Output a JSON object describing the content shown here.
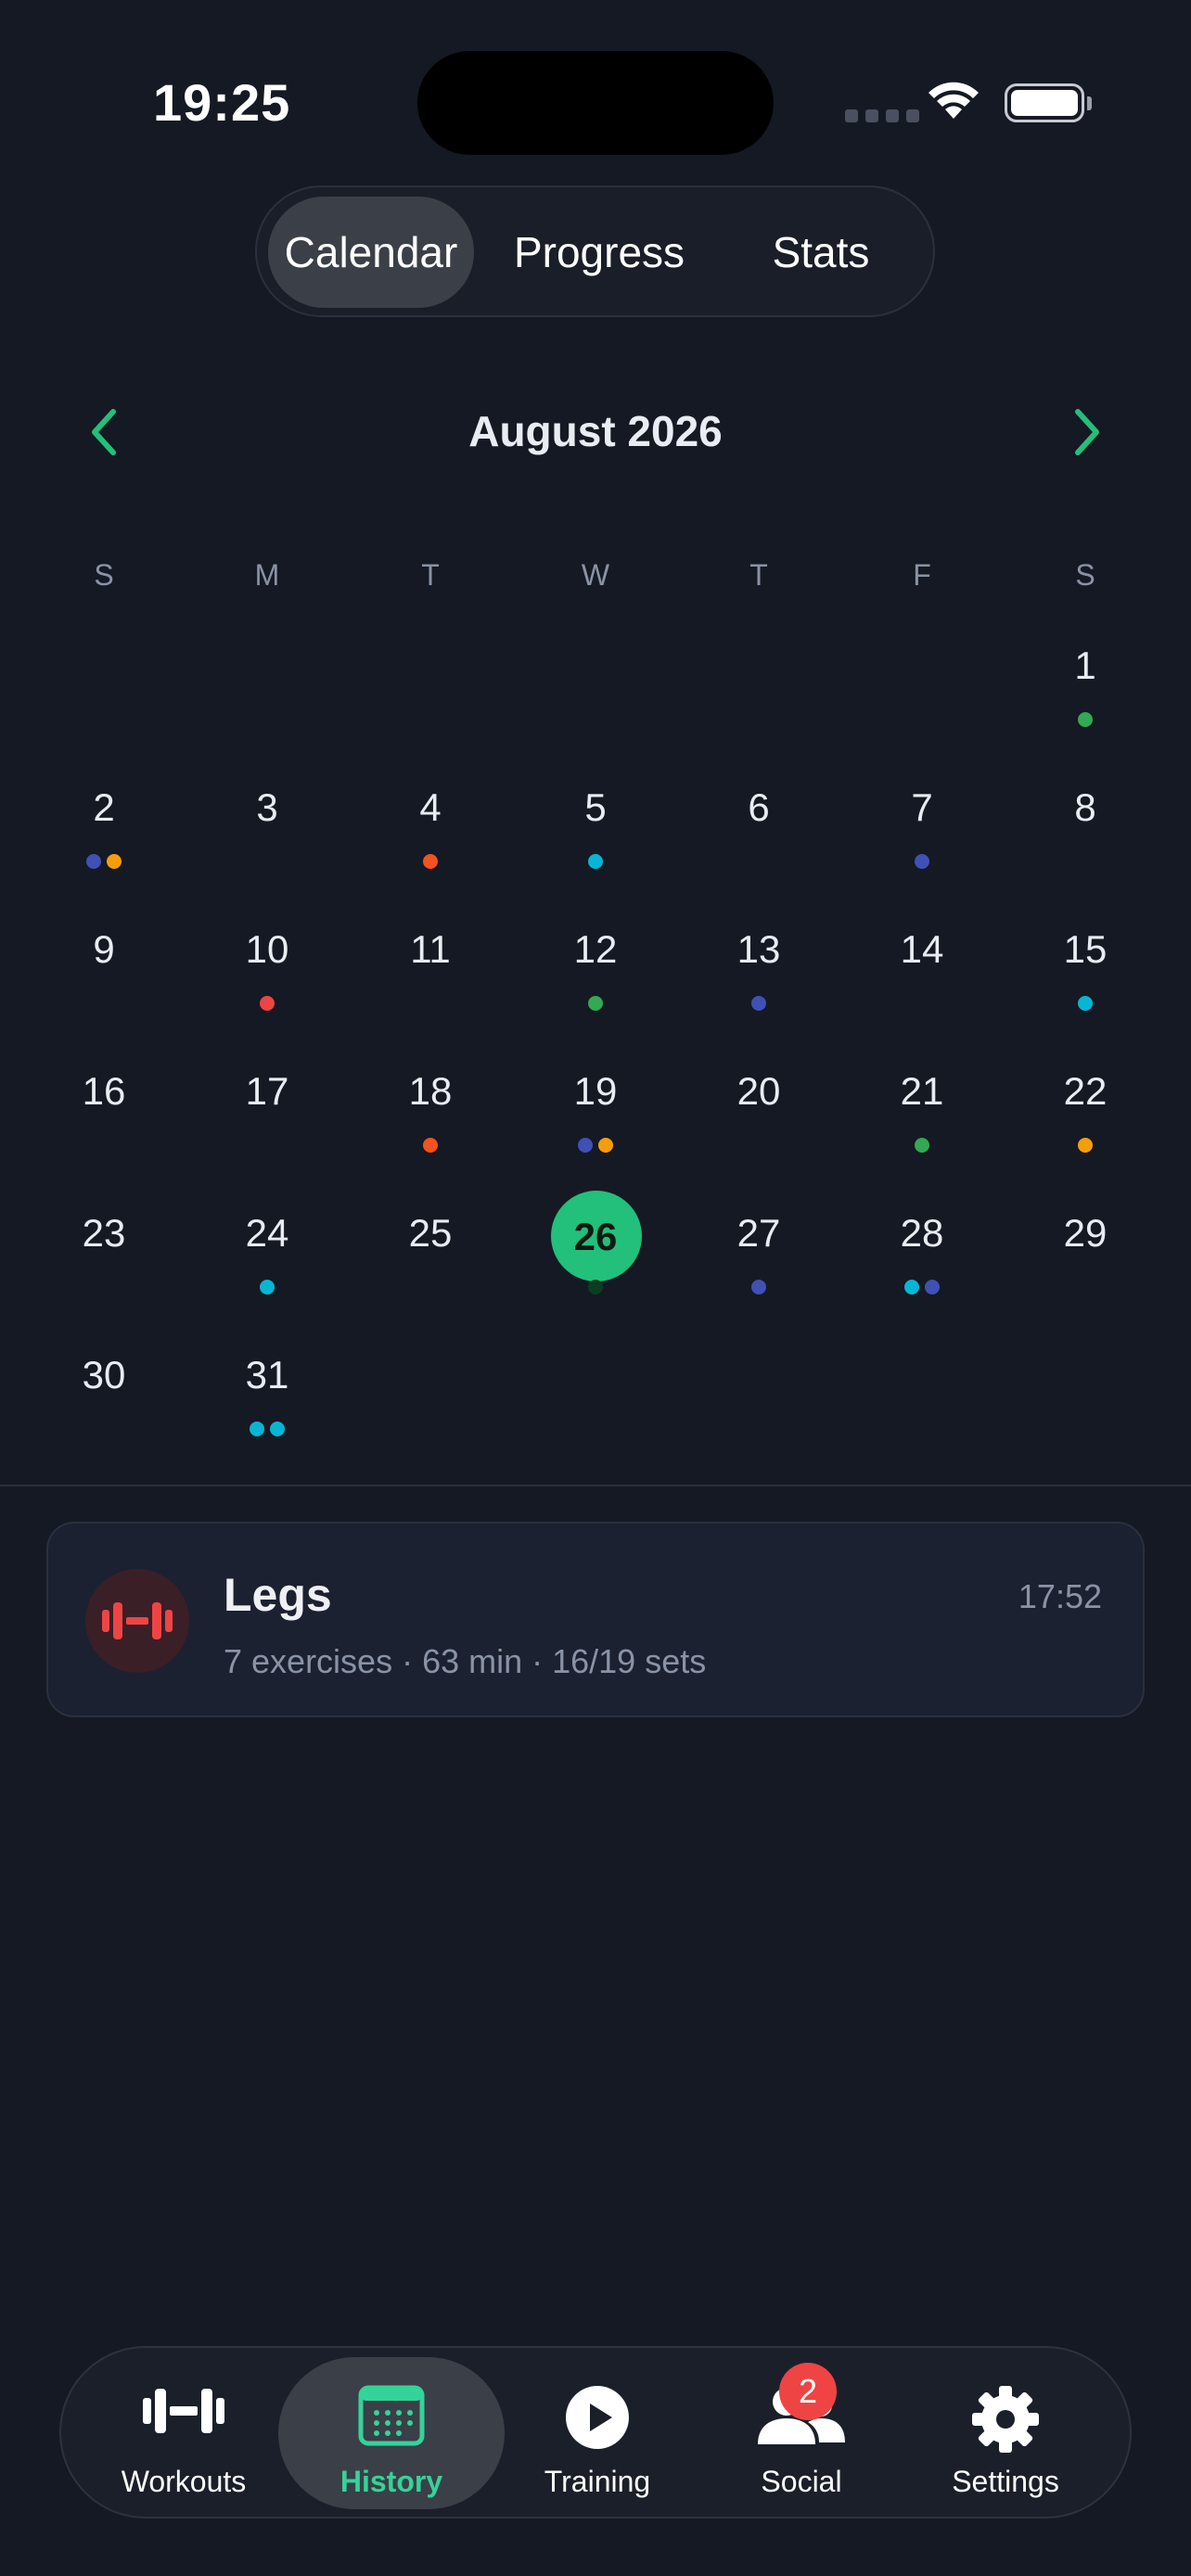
{
  "status_bar": {
    "time": "19:25"
  },
  "segmented": {
    "calendar": "Calendar",
    "progress": "Progress",
    "stats": "Stats",
    "selected": "Calendar"
  },
  "calendar": {
    "month_title": "August 2026",
    "weekdays": [
      "S",
      "M",
      "T",
      "W",
      "T",
      "F",
      "S"
    ],
    "today": 26,
    "days": [
      {
        "n": "1",
        "col": 6,
        "row": 0,
        "dots": [
          "green"
        ]
      },
      {
        "n": "2",
        "col": 0,
        "row": 1,
        "dots": [
          "indigo",
          "orange"
        ]
      },
      {
        "n": "3",
        "col": 1,
        "row": 1,
        "dots": []
      },
      {
        "n": "4",
        "col": 2,
        "row": 1,
        "dots": [
          "red-orange"
        ]
      },
      {
        "n": "5",
        "col": 3,
        "row": 1,
        "dots": [
          "cyan"
        ]
      },
      {
        "n": "6",
        "col": 4,
        "row": 1,
        "dots": []
      },
      {
        "n": "7",
        "col": 5,
        "row": 1,
        "dots": [
          "indigo"
        ]
      },
      {
        "n": "8",
        "col": 6,
        "row": 1,
        "dots": []
      },
      {
        "n": "9",
        "col": 0,
        "row": 2,
        "dots": []
      },
      {
        "n": "10",
        "col": 1,
        "row": 2,
        "dots": [
          "red"
        ]
      },
      {
        "n": "11",
        "col": 2,
        "row": 2,
        "dots": []
      },
      {
        "n": "12",
        "col": 3,
        "row": 2,
        "dots": [
          "green"
        ]
      },
      {
        "n": "13",
        "col": 4,
        "row": 2,
        "dots": [
          "indigo"
        ]
      },
      {
        "n": "14",
        "col": 5,
        "row": 2,
        "dots": []
      },
      {
        "n": "15",
        "col": 6,
        "row": 2,
        "dots": [
          "cyan"
        ]
      },
      {
        "n": "16",
        "col": 0,
        "row": 3,
        "dots": []
      },
      {
        "n": "17",
        "col": 1,
        "row": 3,
        "dots": []
      },
      {
        "n": "18",
        "col": 2,
        "row": 3,
        "dots": [
          "red-orange"
        ]
      },
      {
        "n": "19",
        "col": 3,
        "row": 3,
        "dots": [
          "indigo",
          "orange"
        ]
      },
      {
        "n": "20",
        "col": 4,
        "row": 3,
        "dots": []
      },
      {
        "n": "21",
        "col": 5,
        "row": 3,
        "dots": [
          "green"
        ]
      },
      {
        "n": "22",
        "col": 6,
        "row": 3,
        "dots": [
          "orange"
        ]
      },
      {
        "n": "23",
        "col": 0,
        "row": 4,
        "dots": []
      },
      {
        "n": "24",
        "col": 1,
        "row": 4,
        "dots": [
          "cyan"
        ]
      },
      {
        "n": "25",
        "col": 2,
        "row": 4,
        "dots": []
      },
      {
        "n": "26",
        "col": 3,
        "row": 4,
        "dots": [
          "dark-green"
        ]
      },
      {
        "n": "27",
        "col": 4,
        "row": 4,
        "dots": [
          "indigo"
        ]
      },
      {
        "n": "28",
        "col": 5,
        "row": 4,
        "dots": [
          "cyan",
          "indigo"
        ]
      },
      {
        "n": "29",
        "col": 6,
        "row": 4,
        "dots": []
      },
      {
        "n": "30",
        "col": 0,
        "row": 5,
        "dots": []
      },
      {
        "n": "31",
        "col": 1,
        "row": 5,
        "dots": [
          "cyan",
          "cyan"
        ]
      }
    ]
  },
  "dot_colors": {
    "green": "#34a853",
    "indigo": "#3f51b5",
    "orange": "#f59e0b",
    "red-orange": "#f4511e",
    "cyan": "#06b6d4",
    "red": "#ef4444",
    "dark-green": "#0b3d22"
  },
  "workout": {
    "title": "Legs",
    "subtitle": "7 exercises · 63 min · 16/19 sets",
    "time": "17:52",
    "icon": "dumbbell-icon",
    "accent": "#ef4444"
  },
  "tabbar": {
    "items": [
      {
        "label": "Workouts",
        "icon": "dumbbell-icon"
      },
      {
        "label": "History",
        "icon": "calendar-icon",
        "active": true
      },
      {
        "label": "Training",
        "icon": "play-icon"
      },
      {
        "label": "Social",
        "icon": "people-icon"
      },
      {
        "label": "Settings",
        "icon": "gear-icon"
      }
    ],
    "social_badge": "2"
  },
  "colors": {
    "accent": "#22c07a",
    "background": "#151923",
    "card": "#1b2130",
    "muted": "#8a93a6"
  }
}
